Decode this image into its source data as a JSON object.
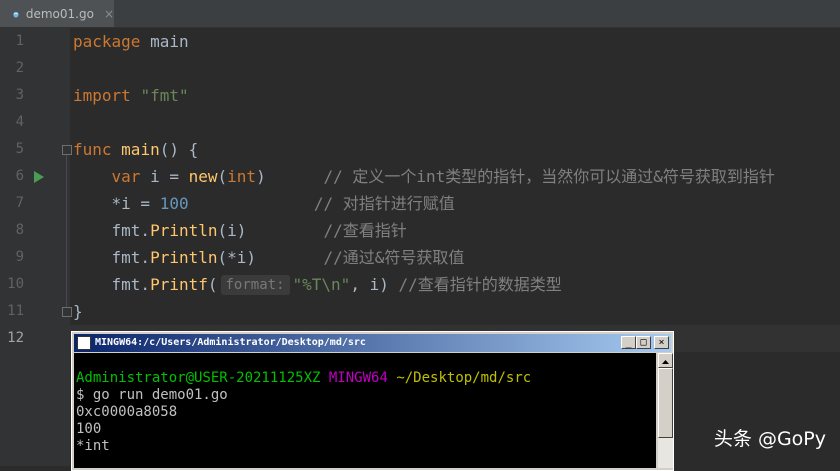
{
  "tab": {
    "filename": "demo01.go",
    "close": "×"
  },
  "gutter": {
    "lines": [
      "1",
      "2",
      "3",
      "4",
      "5",
      "6",
      "7",
      "8",
      "9",
      "10",
      "11",
      "12"
    ]
  },
  "code": {
    "l1": {
      "kw": "package",
      "rest": " main"
    },
    "l3": {
      "kw": "import",
      "str": "\"fmt\""
    },
    "l5": {
      "kw": "func",
      "fn": "main",
      "rest": "() {"
    },
    "l6": {
      "indent": "    ",
      "kw1": "var",
      "mid1": " i = ",
      "fn": "new",
      "p1": "(",
      "kw2": "int",
      "p2": ")",
      "pad": "      ",
      "comment": "// 定义一个int类型的指针，当然你可以通过&符号获取到指针"
    },
    "l7": {
      "indent": "    ",
      "mid": "*i = ",
      "num": "100",
      "pad": "             ",
      "comment": "// 对指针进行赋值"
    },
    "l8": {
      "indent": "    ",
      "pkg": "fmt.",
      "fn": "Println",
      "args": "(i)",
      "pad": "        ",
      "comment": "//查看指针"
    },
    "l9": {
      "indent": "    ",
      "pkg": "fmt.",
      "fn": "Println",
      "args": "(*i)",
      "pad": "       ",
      "comment": "//通过&符号获取值"
    },
    "l10": {
      "indent": "    ",
      "pkg": "fmt.",
      "fn": "Printf",
      "open": "(",
      "hint": "format:",
      "str": "\"%T\\n\"",
      "rest": ", i) ",
      "comment": "//查看指针的数据类型"
    },
    "l11": {
      "text": "}"
    }
  },
  "terminal": {
    "title": "MINGW64:/c/Users/Administrator/Desktop/md/src",
    "min": "_",
    "max": "□",
    "close": "×",
    "prompt_user": "Administrator@USER-20211125XZ",
    "prompt_env": "MINGW64",
    "prompt_path": "~/Desktop/md/src",
    "command": "$ go run demo01.go",
    "output": [
      "0xc0000a8058",
      "100",
      "*int"
    ]
  },
  "watermark": "头条 @GoPy"
}
